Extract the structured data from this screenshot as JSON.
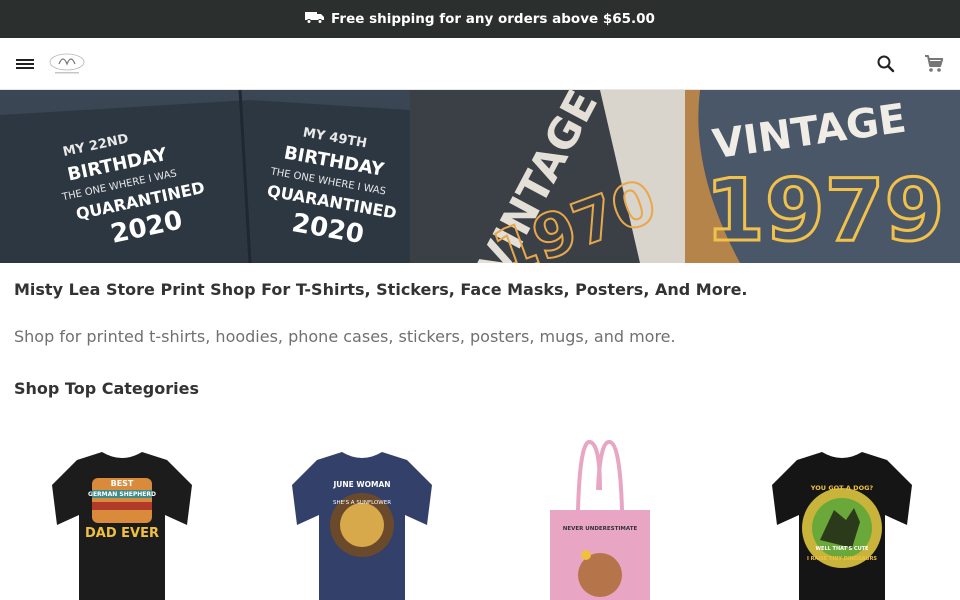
{
  "announcement": {
    "icon": "truck-icon",
    "text": "Free shipping for any orders above $65.00"
  },
  "header": {
    "menu_icon": "menu-icon",
    "logo_alt": "Misty Lea Store logo",
    "search_icon": "search-icon",
    "cart_icon": "cart-icon"
  },
  "hero": {
    "panels": [
      {
        "lines": [
          "MY 22ND",
          "BIRTHDAY",
          "THE ONE WHERE I WAS",
          "QUARANTINED",
          "2020"
        ]
      },
      {
        "lines": [
          "MY 49TH",
          "BIRTHDAY",
          "THE ONE WHERE I WAS",
          "QUARANTINED",
          "2020"
        ]
      },
      {
        "lines": [
          "VINTAGE",
          "1970"
        ]
      },
      {
        "lines": [
          "VINTAGE",
          "1979"
        ]
      }
    ]
  },
  "main": {
    "title": "Misty Lea Store Print Shop For T-Shirts, Stickers, Face Masks, Posters, And More.",
    "description": "Shop for printed t-shirts, hoodies, phone cases, stickers, posters, mugs, and more.",
    "categories_heading": "Shop Top Categories"
  },
  "categories": [
    {
      "name": "best-german-shepherd-dad-ever-shirt",
      "print_top": "BEST",
      "print_mid": "GERMAN SHEPHERD",
      "print_bottom": "DAD EVER",
      "shirt_color": "#1c1c1c"
    },
    {
      "name": "june-woman-shirt",
      "print_top": "JUNE WOMAN",
      "print_mid": "SHE'S A SUNFLOWER",
      "print_bottom": "",
      "shirt_color": "#33406a"
    },
    {
      "name": "never-underestimate-tote-bag",
      "print_top": "NEVER UNDERESTIMATE",
      "print_mid": "",
      "print_bottom": "",
      "shirt_color": "#e8a6c4"
    },
    {
      "name": "you-got-a-dog-dinosaurs-shirt",
      "print_top": "YOU GOT A DOG?",
      "print_mid": "WELL THAT'S CUTE",
      "print_bottom": "I RAISE TINY DINOSAURS",
      "shirt_color": "#151515"
    }
  ]
}
